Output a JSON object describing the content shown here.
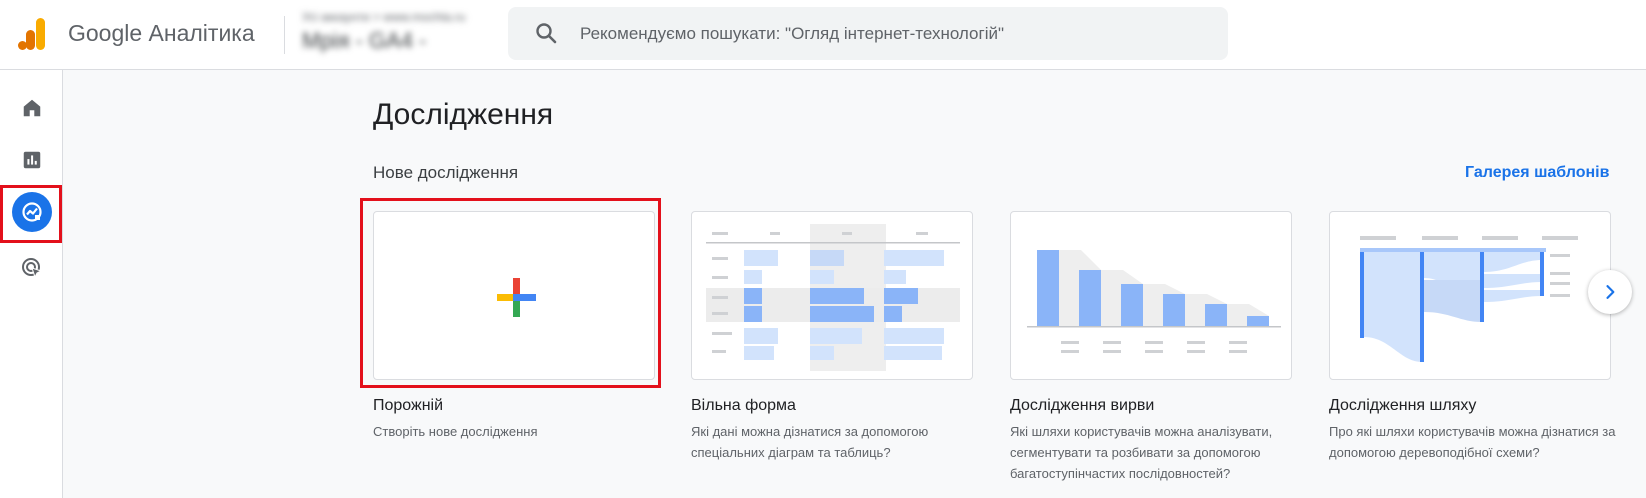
{
  "header": {
    "app_title": "Google Аналітика",
    "account_line1": "Усі аккаунти > www.mochta.ru",
    "account_line2": "Мрія - GA4 -",
    "search_placeholder": "Рекомендуємо пошукати: \"Огляд інтернет-технологій\""
  },
  "nav": {
    "items": [
      {
        "icon": "home-icon",
        "active": false
      },
      {
        "icon": "reports-icon",
        "active": false
      },
      {
        "icon": "explore-icon",
        "active": true
      },
      {
        "icon": "advertising-icon",
        "active": false
      }
    ]
  },
  "main": {
    "page_title": "Дослідження",
    "section_title": "Нове дослідження",
    "gallery_link": "Галерея шаблонів",
    "cards": [
      {
        "title": "Порожній",
        "desc": "Створіть нове дослідження"
      },
      {
        "title": "Вільна форма",
        "desc": "Які дані можна дізнатися за допомогою спеціальних діаграм та таблиць?"
      },
      {
        "title": "Дослідження вирви",
        "desc": "Які шляхи користувачів можна аналізувати, сегментувати та розбивати за допомогою багатоступінчастих послідовностей?"
      },
      {
        "title": "Дослідження шляху",
        "desc": "Про які шляхи користувачів можна дізнатися за допомогою деревоподібної схеми?"
      }
    ]
  },
  "colors": {
    "accent": "#1a73e8",
    "highlight_border": "#e3101b",
    "logo_orange": "#f9ab00",
    "logo_dark_orange": "#e37400"
  }
}
